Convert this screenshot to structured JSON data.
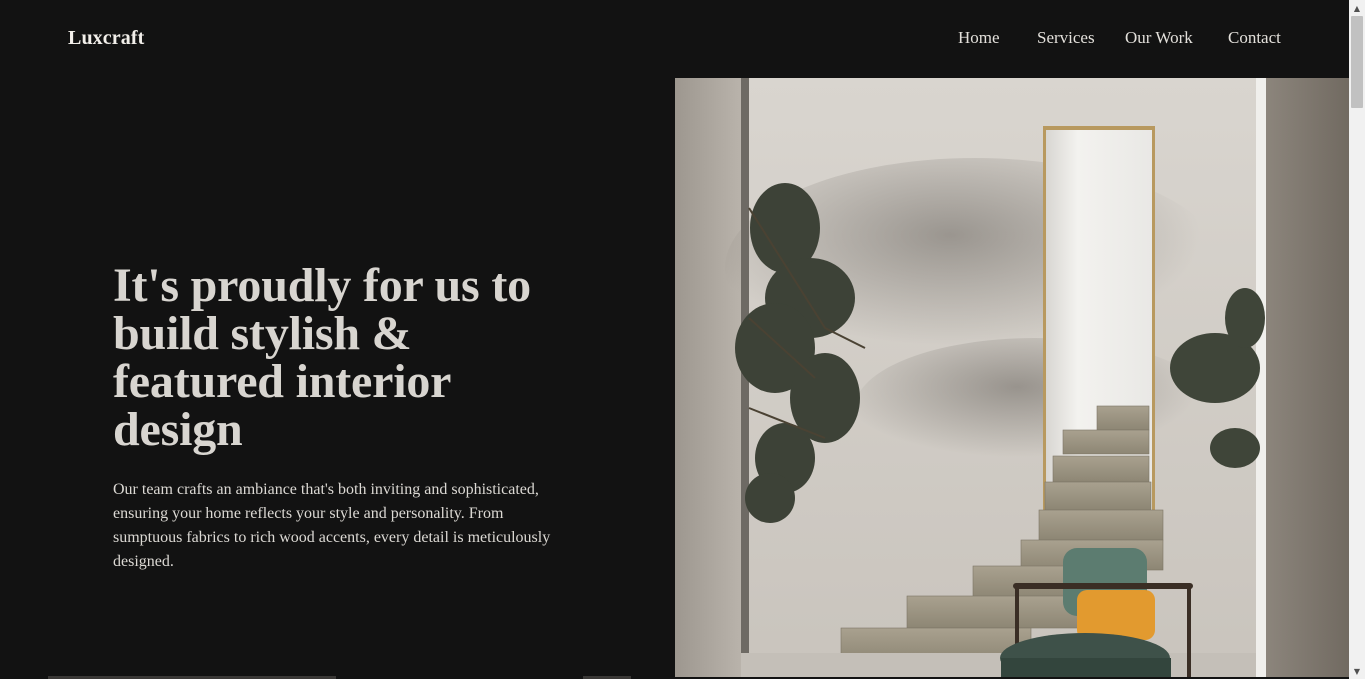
{
  "header": {
    "logo": "Luxcraft",
    "nav": [
      {
        "label": "Home"
      },
      {
        "label": "Services"
      },
      {
        "label": "Our Work"
      },
      {
        "label": "Contact"
      }
    ]
  },
  "hero": {
    "headline": "It's proudly for us to build stylish & featured interior design",
    "lead": "Our team crafts an ambiance that's both inviting and sophisticated, ensuring your home reflects your style and personality. From sumptuous fabrics to rich wood accents, every detail is meticulously designed.",
    "image_alt": "Interior with stone staircase, green armchair and olive tree"
  },
  "colors": {
    "background": "#121212",
    "text": "#d8d5d0",
    "wall": "#cfcac4"
  },
  "scrollbar": {
    "up_icon": "scroll-up-arrow-icon",
    "down_icon": "scroll-down-arrow-icon"
  }
}
